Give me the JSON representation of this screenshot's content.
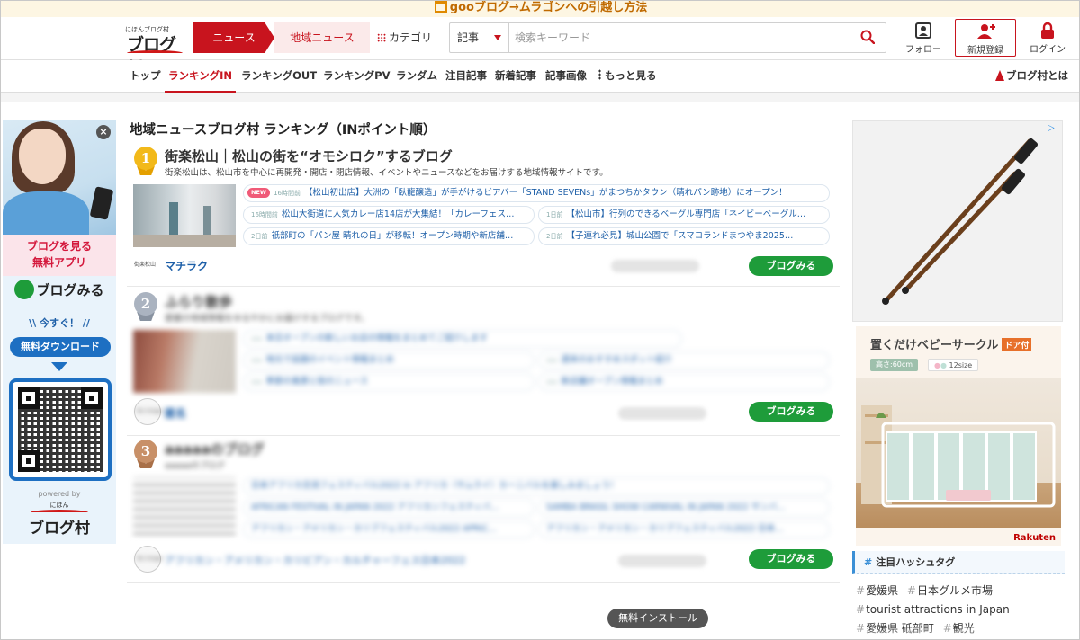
{
  "notice": "gooブログ→ムラゴンへの引越し方法",
  "logo": {
    "small": "にほんブログ村",
    "big": "ブログ村"
  },
  "header": {
    "tab_news": "ニュース",
    "tab_local": "地域ニュース",
    "tab_category": "カテゴリ",
    "search_select": "記事",
    "search_placeholder": "検索キーワード",
    "follow": "フォロー",
    "register": "新規登録",
    "login": "ログイン"
  },
  "nav": {
    "items": [
      "トップ",
      "ランキングIN",
      "ランキングOUT",
      "ランキングPV",
      "ランダム",
      "注目記事",
      "新着記事",
      "記事画像",
      "もっと見る"
    ],
    "about": "ブログ村とは"
  },
  "left_ad": {
    "pink_text": "ブログを見る\n無料アプリ",
    "brand": "ブログみる",
    "now": "\\\\ 今すぐ！ //",
    "download": "無料ダウンロード",
    "powered": "powered by",
    "plogo_small": "にほん",
    "plogo_big": "ブログ村"
  },
  "page_title": "地域ニュースブログ村 ランキング（INポイント順）",
  "entries": [
    {
      "rank": "1",
      "title": "街楽松山｜松山の街を“オモシロク”するブログ",
      "desc": "街楽松山は、松山市を中心に再開発・開店・閉店情報、イベントやニュースなどをお届けする地域情報サイトです。",
      "new_badge": "NEW",
      "articles": [
        {
          "time": "16時間前",
          "text": "【松山初出店】大洲の「臥龍醸造」が手がけるビアバー「STAND SEVENs」がまつちかタウン（晴れパン跡地）にオープン！"
        },
        {
          "time": "16時間前",
          "text": "松山大街道に人気カレー店14店が大集結！「カレーフェス…"
        },
        {
          "time": "1日前",
          "text": "【松山市】行列のできるベーグル専門店「ネイビーベーグル…"
        },
        {
          "time": "2日前",
          "text": "祇部町の「パン屋 晴れの日」が移転！オープン時期や新店舗…"
        },
        {
          "time": "2日前",
          "text": "【子連れ必見】城山公園で「スマコランドまつやま2025…"
        }
      ],
      "author_icon": "街楽松山",
      "author": "マチラク",
      "visit": "ブログみる"
    },
    {
      "rank": "2",
      "title": "ふらり散歩",
      "desc": "愛媛の地域情報をゆるやかにお届けするブログです。",
      "articles": [
        {
          "time": "xxx",
          "text": "本日オープンの新しいお店の情報をまとめてご紹介します"
        },
        {
          "time": "xxx",
          "text": "地元で話題のイベント情報まとめ"
        },
        {
          "time": "xxx",
          "text": "週末のおすすめスポット紹介"
        },
        {
          "time": "xxx",
          "text": "季節の風景と街のニュース"
        },
        {
          "time": "xxx",
          "text": "新店舗オープン情報まとめ"
        }
      ],
      "author_icon": "No Image",
      "author": "匿名",
      "visit": "ブログみる"
    },
    {
      "rank": "3",
      "title": "aaaaaのブログ",
      "desc": "aaaaaのブログ",
      "articles": [
        {
          "time": "",
          "text": "日本アフリカ交流フェスティバル2022 in アフリカ〈サムライ〉カーニバルを楽しみましょう！"
        },
        {
          "time": "",
          "text": "AFRICAN FESTIVAL IN JAPAN 2022 アフリカンフェスティバ…"
        },
        {
          "time": "",
          "text": "SAMBA BRASIL SHOW CARNIVAL IN JAPAN 2022 サンバ…"
        },
        {
          "time": "",
          "text": "アフリカン・アメリカン・カリブフェスティバル2022 APRIC…"
        },
        {
          "time": "",
          "text": "アフリカン・アメリカン・カリブフェスティバル2022 日本…"
        }
      ],
      "author_icon": "No Image",
      "author": "アフリカン・アメリカン・カリビアン・カルチャーフェス日本2022",
      "visit": "ブログみる"
    }
  ],
  "right_ad": {
    "title": "置くだけベビーサークル",
    "badge": "ドア付",
    "size1": "高さ:60cm",
    "size2": "12size",
    "brand": "Rakuten",
    "adtag": "▷"
  },
  "tags": {
    "heading": "注目ハッシュタグ",
    "items": [
      "愛媛県",
      "日本グルメ市場",
      "tourist attractions in Japan",
      "愛媛県 砥部町",
      "観光"
    ]
  },
  "install": "無料インストール",
  "colors": {
    "brand_red": "#c8141e",
    "visit_green": "#1e9c3a",
    "link_blue": "#1d5fa8"
  }
}
